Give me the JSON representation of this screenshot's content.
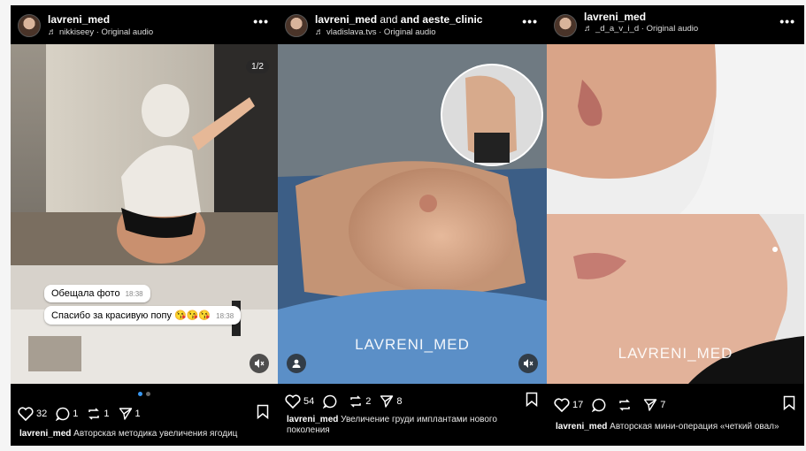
{
  "posts": [
    {
      "username": "lavreni_med",
      "username_suffix": "",
      "audio": "nikkiseey · Original audio",
      "counter": "1/2",
      "bubbles": [
        {
          "text": "Обещала фото",
          "time": "18:38"
        },
        {
          "text": "Спасибо за красивую попу 😘😘😘",
          "time": "18:38"
        }
      ],
      "watermark": "",
      "stats": {
        "likes": "32",
        "comments": "1",
        "reposts": "1",
        "shares": "1"
      },
      "caption_user": "lavreni_med",
      "caption_text": "Авторская методика увеличения ягодиц"
    },
    {
      "username": "lavreni_med",
      "username_suffix": "and aeste_clinic",
      "audio": "vladislava.tvs · Original audio",
      "counter": "",
      "bubbles": [],
      "watermark": "LAVRENI_MED",
      "stats": {
        "likes": "54",
        "comments": "",
        "reposts": "2",
        "shares": "8"
      },
      "caption_user": "lavreni_med",
      "caption_text": "Увеличение груди имплантами нового поколения"
    },
    {
      "username": "lavreni_med",
      "username_suffix": "",
      "audio": "_d_a_v_i_d · Original audio",
      "counter": "",
      "bubbles": [],
      "watermark": "LAVRENI_MED",
      "stats": {
        "likes": "17",
        "comments": "",
        "reposts": "",
        "shares": "7"
      },
      "caption_user": "lavreni_med",
      "caption_text": "Авторская мини-операция «четкий овал»"
    }
  ],
  "icons": {
    "more": "more-dots-icon",
    "audio": "music-note-icon",
    "like": "heart-icon",
    "comment": "comment-icon",
    "repost": "repost-icon",
    "share": "send-icon",
    "save": "bookmark-icon",
    "mute": "muted-speaker-icon",
    "tag": "user-tag-icon"
  },
  "colors": {
    "background": "#000000",
    "text": "#ffffff",
    "active_dot": "#3897f0"
  }
}
